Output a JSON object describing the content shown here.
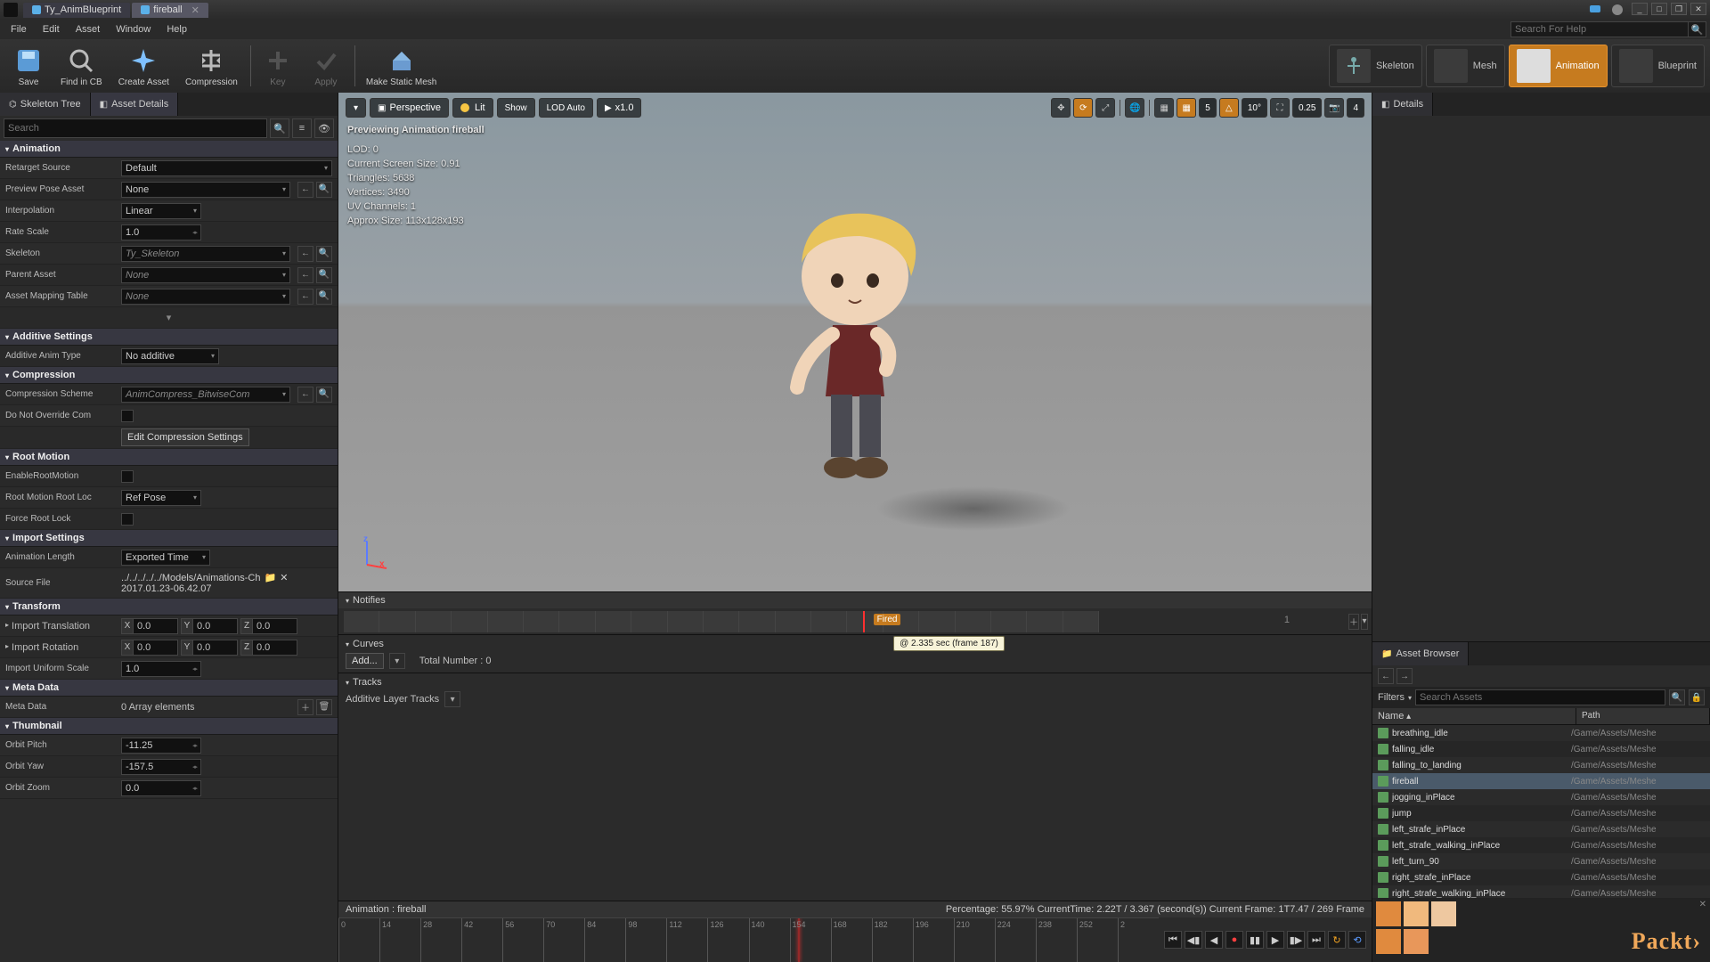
{
  "titlebar": {
    "tabs": [
      {
        "label": "Ty_AnimBlueprint"
      },
      {
        "label": "fireball"
      }
    ]
  },
  "menus": [
    "File",
    "Edit",
    "Asset",
    "Window",
    "Help"
  ],
  "search_help_placeholder": "Search For Help",
  "toolbar_buttons": {
    "save": "Save",
    "find": "Find in CB",
    "create": "Create Asset",
    "compress": "Compression",
    "key": "Key",
    "apply": "Apply",
    "makemesh": "Make Static Mesh"
  },
  "mode_buttons": {
    "skeleton": "Skeleton",
    "mesh": "Mesh",
    "animation": "Animation",
    "blueprint": "Blueprint"
  },
  "left_tabs": {
    "skeleton": "Skeleton Tree",
    "details": "Asset Details"
  },
  "details_placeholder": "Search",
  "cats": {
    "animation": "Animation",
    "additive": "Additive Settings",
    "compression": "Compression",
    "root": "Root Motion",
    "import": "Import Settings",
    "transform": "Transform",
    "meta": "Meta Data",
    "thumb": "Thumbnail"
  },
  "props": {
    "retarget": {
      "label": "Retarget Source",
      "value": "Default"
    },
    "preview_pose": {
      "label": "Preview Pose Asset",
      "value": "None"
    },
    "interp": {
      "label": "Interpolation",
      "value": "Linear"
    },
    "rate": {
      "label": "Rate Scale",
      "value": "1.0"
    },
    "skeleton_prop": {
      "label": "Skeleton",
      "value": "Ty_Skeleton"
    },
    "parent": {
      "label": "Parent Asset",
      "value": "None"
    },
    "asset_map": {
      "label": "Asset Mapping Table",
      "value": "None"
    },
    "add_type": {
      "label": "Additive Anim Type",
      "value": "No additive"
    },
    "comp_scheme": {
      "label": "Compression Scheme",
      "value": "AnimCompress_BitwiseCom"
    },
    "do_not_override": {
      "label": "Do Not Override Com"
    },
    "edit_comp_btn": "Edit Compression Settings",
    "enable_root": {
      "label": "EnableRootMotion"
    },
    "root_lock": {
      "label": "Root Motion Root Loc",
      "value": "Ref Pose"
    },
    "force_root": {
      "label": "Force Root Lock"
    },
    "anim_len": {
      "label": "Animation Length",
      "value": "Exported Time"
    },
    "source_file": {
      "label": "Source File",
      "path": "../../../../../Models/Animations-Ch",
      "date": "2017.01.23-06.42.07"
    },
    "imp_trans": {
      "label": "Import Translation",
      "x": "0.0",
      "y": "0.0",
      "z": "0.0"
    },
    "imp_rot": {
      "label": "Import Rotation",
      "x": "0.0",
      "y": "0.0",
      "z": "0.0"
    },
    "imp_scale": {
      "label": "Import Uniform Scale",
      "value": "1.0"
    },
    "meta_data": {
      "label": "Meta Data",
      "value": "0 Array elements"
    },
    "orbit_pitch": {
      "label": "Orbit Pitch",
      "value": "-11.25"
    },
    "orbit_yaw": {
      "label": "Orbit Yaw",
      "value": "-157.5"
    },
    "orbit_zoom": {
      "label": "Orbit Zoom",
      "value": "0.0"
    }
  },
  "viewport": {
    "perspective": "Perspective",
    "lit": "Lit",
    "show": "Show",
    "lod": "LOD Auto",
    "speed": "x1.0",
    "grid_num": "5",
    "angle": "10°",
    "cam_speed": "0.25",
    "preview_count": "4",
    "overlay_title": "Previewing Animation fireball",
    "overlay_lines": [
      "LOD: 0",
      "Current Screen Size: 0.91",
      "Triangles: 5638",
      "Vertices: 3490",
      "UV Channels: 1",
      "Approx Size: 113x128x193"
    ]
  },
  "notifies_label": "Notifies",
  "notify_marker": {
    "name": "Fired",
    "tooltip": "@ 2.335 sec (frame 187)"
  },
  "notify_one": "1",
  "curves": {
    "title": "Curves",
    "add_btn": "Add...",
    "total": "Total Number : 0"
  },
  "tracks": {
    "title": "Tracks",
    "layer": "Additive Layer Tracks"
  },
  "timeline_status_left": "Animation :   fireball",
  "timeline_status_right": "Percentage:  55.97% CurrentTime:  2.22T / 3.367 (second(s)) Current Frame:  1T7.47 / 269 Frame",
  "timeline_ticks": [
    "0",
    "14",
    "28",
    "42",
    "56",
    "70",
    "84",
    "98",
    "112",
    "126",
    "140",
    "154",
    "168",
    "182",
    "196",
    "210",
    "224",
    "238",
    "252",
    "2"
  ],
  "details_tab": "Details",
  "asset_browser": {
    "title": "Asset Browser",
    "filters": "Filters",
    "search_placeholder": "Search Assets",
    "cols": {
      "name": "Name",
      "path": "Path"
    },
    "rows": [
      {
        "name": "breathing_idle",
        "path": "/Game/Assets/Meshe"
      },
      {
        "name": "falling_idle",
        "path": "/Game/Assets/Meshe"
      },
      {
        "name": "falling_to_landing",
        "path": "/Game/Assets/Meshe"
      },
      {
        "name": "fireball",
        "path": "/Game/Assets/Meshe",
        "sel": true
      },
      {
        "name": "jogging_inPlace",
        "path": "/Game/Assets/Meshe"
      },
      {
        "name": "jump",
        "path": "/Game/Assets/Meshe"
      },
      {
        "name": "left_strafe_inPlace",
        "path": "/Game/Assets/Meshe"
      },
      {
        "name": "left_strafe_walking_inPlace",
        "path": "/Game/Assets/Meshe"
      },
      {
        "name": "left_turn_90",
        "path": "/Game/Assets/Meshe"
      },
      {
        "name": "right_strafe_inPlace",
        "path": "/Game/Assets/Meshe"
      },
      {
        "name": "right_strafe_walking_inPlace",
        "path": "/Game/Assets/Meshe"
      }
    ]
  },
  "packt": "Packt›"
}
